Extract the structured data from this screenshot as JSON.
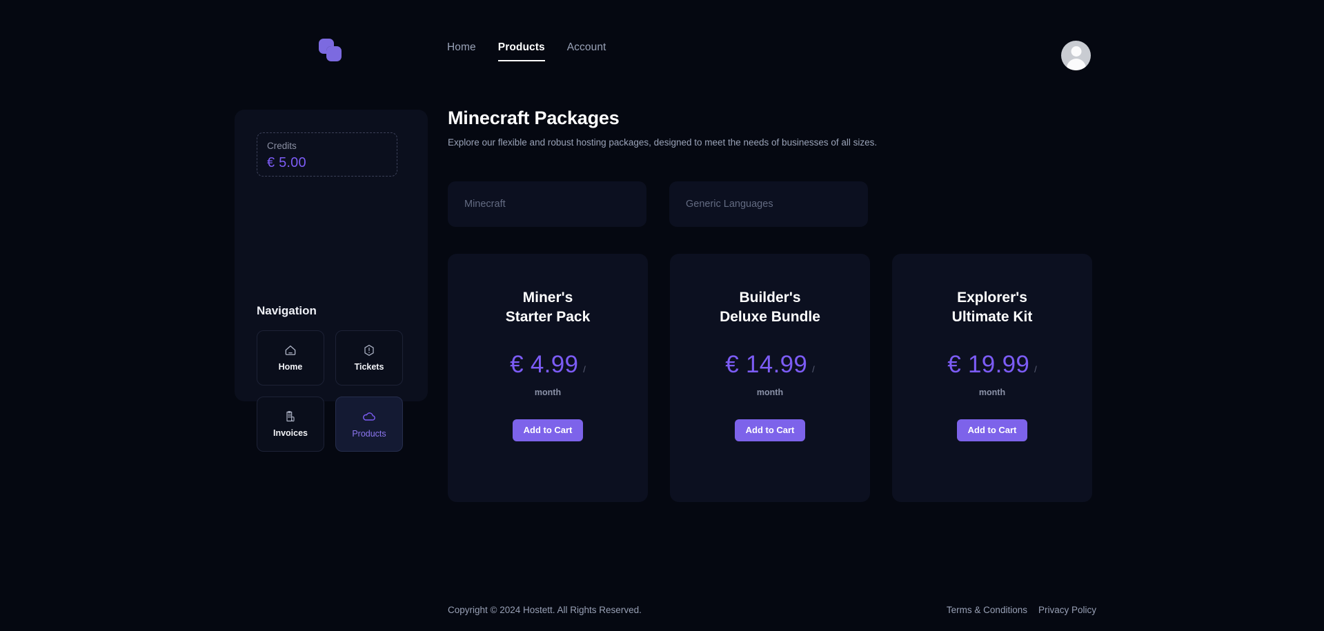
{
  "header": {
    "logo_icon": "overlapping-squares-logo",
    "nav": [
      {
        "label": "Home",
        "active": false
      },
      {
        "label": "Products",
        "active": true
      },
      {
        "label": "Account",
        "active": false
      }
    ],
    "avatar_icon": "user-avatar"
  },
  "sidebar": {
    "credits": {
      "label": "Credits",
      "value": "€ 5.00"
    },
    "nav_heading": "Navigation",
    "items": [
      {
        "label": "Home",
        "icon": "house-icon",
        "active": false
      },
      {
        "label": "Tickets",
        "icon": "alert-hexagon-icon",
        "active": false
      },
      {
        "label": "Invoices",
        "icon": "receipt-icon",
        "active": false
      },
      {
        "label": "Products",
        "icon": "cloud-icon",
        "active": true
      }
    ]
  },
  "main": {
    "title": "Minecraft Packages",
    "subtitle": "Explore our flexible and robust hosting packages, designed to meet the needs of businesses of all sizes.",
    "categories": [
      {
        "label": "Minecraft"
      },
      {
        "label": "Generic Languages"
      }
    ],
    "packages": [
      {
        "name_line1": "Miner's",
        "name_line2": "Starter Pack",
        "price": "€ 4.99",
        "slash": "/",
        "period": "month",
        "cta": "Add to Cart"
      },
      {
        "name_line1": "Builder's",
        "name_line2": "Deluxe Bundle",
        "price": "€ 14.99",
        "slash": "/",
        "period": "month",
        "cta": "Add to Cart"
      },
      {
        "name_line1": "Explorer's",
        "name_line2": "Ultimate Kit",
        "price": "€ 19.99",
        "slash": "/",
        "period": "month",
        "cta": "Add to Cart"
      }
    ]
  },
  "footer": {
    "copyright": "Copyright © 2024 Hostett. All Rights Reserved.",
    "links": [
      {
        "label": "Terms & Conditions"
      },
      {
        "label": "Privacy Policy"
      }
    ]
  },
  "colors": {
    "page_background": "#050811",
    "panel_background": "#0b0f1d",
    "card_background": "#0c1020",
    "accent_purple": "#7c5cf5",
    "button_purple": "#7d63ea",
    "active_nav_card": "#141a33",
    "muted_text": "#9aa3b8"
  }
}
